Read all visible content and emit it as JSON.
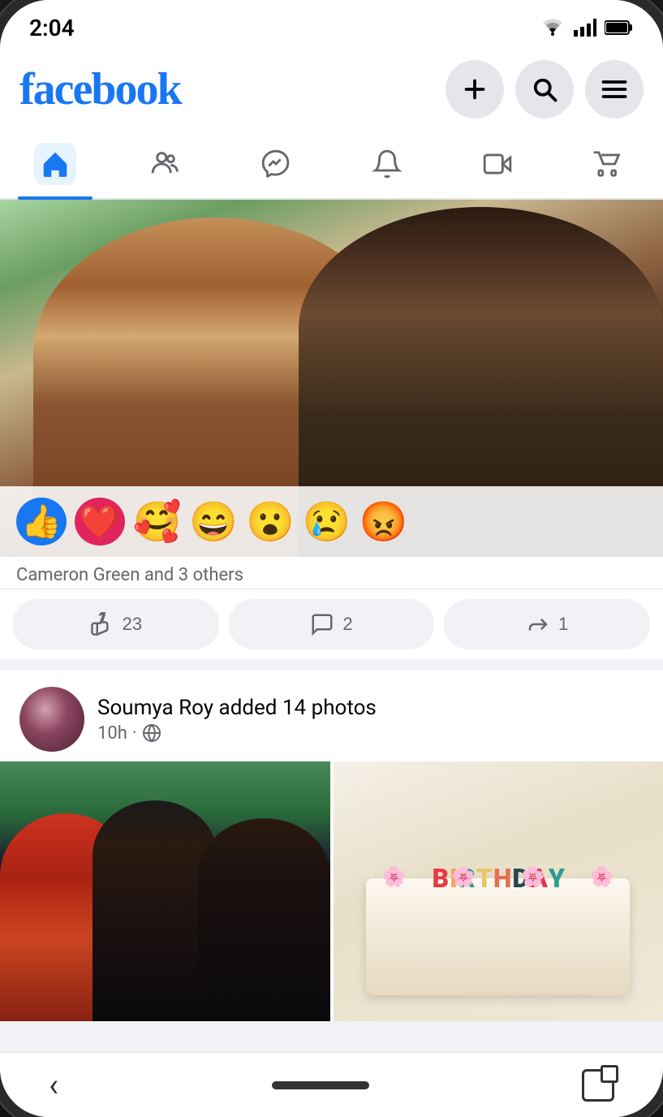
{
  "status_bar": {
    "time": "2:04",
    "wifi": "wifi",
    "signal": "signal",
    "battery": "battery"
  },
  "header": {
    "logo": "facebook",
    "add_label": "+",
    "search_label": "search",
    "menu_label": "menu"
  },
  "nav": {
    "items": [
      {
        "id": "home",
        "label": "Home",
        "active": true
      },
      {
        "id": "friends",
        "label": "Friends",
        "active": false
      },
      {
        "id": "messenger",
        "label": "Messenger",
        "active": false
      },
      {
        "id": "notifications",
        "label": "Notifications",
        "active": false
      },
      {
        "id": "video",
        "label": "Video",
        "active": false
      },
      {
        "id": "marketplace",
        "label": "Marketplace",
        "active": false
      }
    ]
  },
  "posts": [
    {
      "id": "post1",
      "reactions": {
        "emojis": [
          "👍",
          "❤️",
          "🥰",
          "😄",
          "😮",
          "😢",
          "😡"
        ],
        "likes_text": "Cameron Green and 3 others",
        "like_count": "23",
        "comment_count": "2",
        "share_count": "1"
      }
    },
    {
      "id": "post2",
      "author": "Soumya Roy",
      "action": "added",
      "photo_count": "14 photos",
      "time": "10h",
      "privacy": "public"
    }
  ],
  "bottom_nav": {
    "back_label": "<",
    "rotate_label": "rotate"
  }
}
